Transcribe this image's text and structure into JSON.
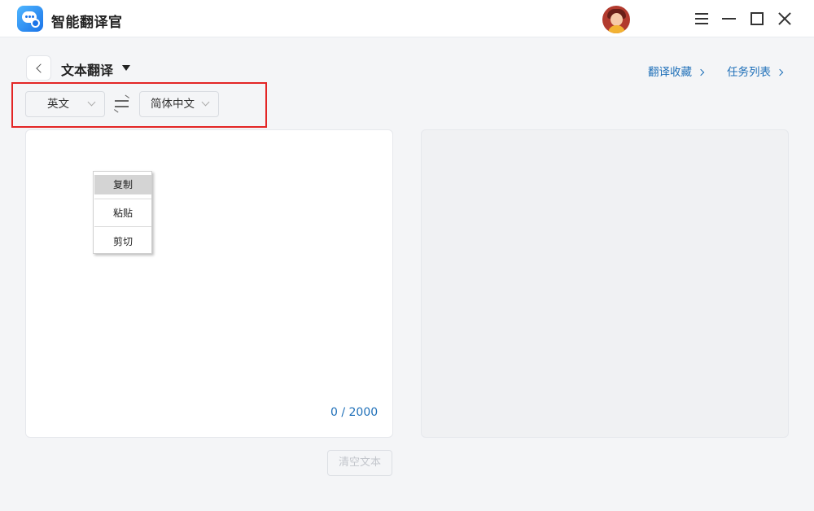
{
  "app": {
    "title": "智能翻译官",
    "logo_icon": "chat-bubble-gear-icon",
    "accent_color": "#1e6fb8",
    "highlight_color": "#e32525"
  },
  "window_controls": {
    "menu_icon": "menu-icon",
    "minimize_icon": "minimize-icon",
    "maximize_icon": "maximize-icon",
    "close_icon": "close-icon"
  },
  "header": {
    "page_title": "文本翻译",
    "favorites_link": "翻译收藏",
    "task_list_link": "任务列表"
  },
  "languages": {
    "source": "英文",
    "target": "简体中文"
  },
  "source_panel": {
    "char_count": "0 / 2000"
  },
  "context_menu": {
    "items": [
      {
        "label": "复制",
        "active": true
      },
      {
        "label": "粘贴",
        "active": false
      },
      {
        "label": "剪切",
        "active": false
      }
    ]
  },
  "actions": {
    "clear_label": "清空文本"
  }
}
